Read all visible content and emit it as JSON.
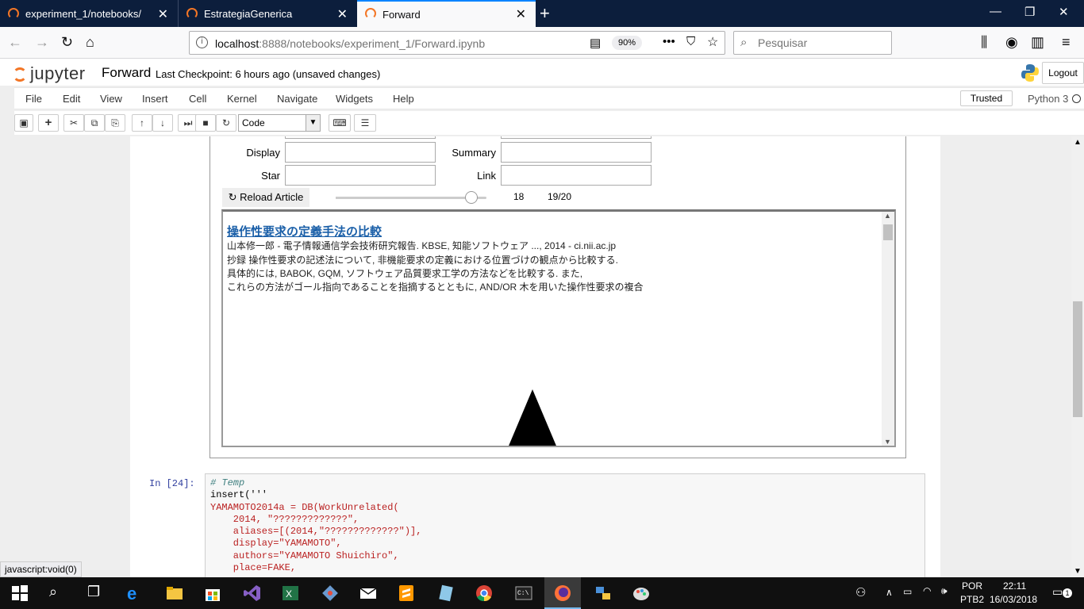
{
  "browser": {
    "tabs": [
      {
        "label": "experiment_1/notebooks/"
      },
      {
        "label": "EstrategiaGenerica"
      },
      {
        "label": "Forward"
      }
    ],
    "url_host": "localhost",
    "url_path": ":8888/notebooks/experiment_1/Forward.ipynb",
    "zoom": "90%",
    "search_placeholder": "Pesquisar"
  },
  "jupyter": {
    "logo_text": "jupyter",
    "notebook_name": "Forward",
    "checkpoint": "Last Checkpoint: 6 hours ago (unsaved changes)",
    "logout": "Logout",
    "menu": [
      "File",
      "Edit",
      "View",
      "Insert",
      "Cell",
      "Kernel",
      "Navigate",
      "Widgets",
      "Help"
    ],
    "trusted": "Trusted",
    "kernel": "Python 3",
    "cell_type": "Code"
  },
  "widget": {
    "display_label": "Display",
    "summary_label": "Summary",
    "star_label": "Star",
    "link_label": "Link",
    "reload_label": "Reload Article",
    "slider_value": "18",
    "slider_position": "19/20",
    "slider_fraction": 0.9
  },
  "article": {
    "title": "操作性要求の定義手法の比較",
    "lines": [
      "山本修一郎 - 電子情報通信学会技術研究報告. KBSE, 知能ソフトウェア ..., 2014 - ci.nii.ac.jp",
      "抄録 操作性要求の記述法について, 非機能要求の定義における位置づけの観点から比較する.",
      "具体的には, BABOK, GQM, ソフトウェア品質要求工学の方法などを比較する. また,",
      "これらの方法がゴール指向であることを指摘するとともに, AND/OR 木を用いた操作性要求の複合"
    ]
  },
  "cell": {
    "prompt": "In [24]:",
    "lines": [
      "# Temp",
      "insert('''",
      "YAMAMOTO2014a = DB(WorkUnrelated(",
      "    2014, \"?????????????\",",
      "    aliases=[(2014,\"?????????????\")],",
      "    display=\"YAMAMOTO\",",
      "    authors=\"YAMAMOTO Shuichiro\",",
      "    place=FAKE,"
    ]
  },
  "statusbar": "javascript:void(0)",
  "taskbar": {
    "lang1": "POR",
    "lang2": "PTB2",
    "time": "22:11",
    "date": "16/03/2018",
    "notif_count": "1"
  }
}
